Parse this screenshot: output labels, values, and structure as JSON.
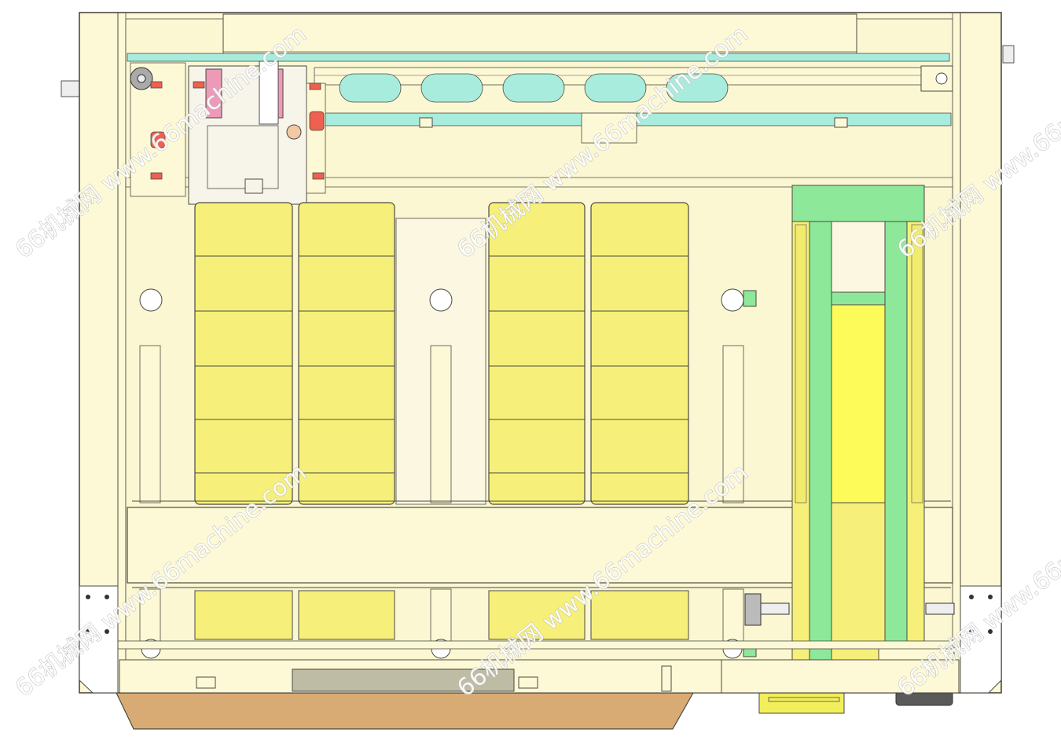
{
  "watermark": {
    "text": "66机械网 www.66machine.com"
  },
  "colors": {
    "frame": "#fdf9d6",
    "frame_inner": "#f7f4cc",
    "outline": "#4a4a42",
    "tray": "#f6f07a",
    "tray_cell": "#f1ec6e",
    "green_rail": "#8ee89a",
    "bright_yellow": "#fdfb5a",
    "cyan": "#a8ecdd",
    "red_clamp": "#ee6050",
    "base_plate": "#d9ab74",
    "grey_slot": "#bfbca6",
    "dark_motor": "#5a5a5a"
  }
}
